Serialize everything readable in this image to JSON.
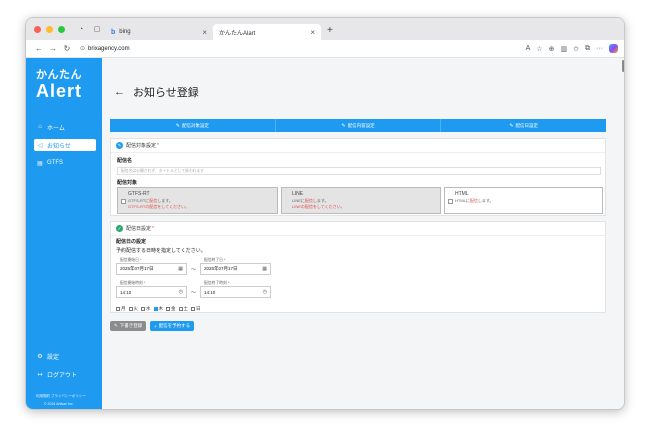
{
  "browser": {
    "tabs": [
      {
        "label": "bing",
        "active": false
      },
      {
        "label": "かんたんAlart",
        "active": true
      }
    ],
    "url": "brixagency.com"
  },
  "sidebar": {
    "logo_top": "かんたん",
    "logo_bottom": "Alert",
    "items": [
      {
        "label": "ホーム",
        "icon": "home-icon"
      },
      {
        "label": "お知らせ",
        "icon": "megaphone-icon",
        "active": true
      },
      {
        "label": "GTFS",
        "icon": "file-icon"
      }
    ],
    "bottom_items": [
      {
        "label": "設定",
        "icon": "gear-icon"
      },
      {
        "label": "ログアウト",
        "icon": "logout-icon"
      }
    ],
    "footer_links": "利用規約   プライバシーポリシー",
    "footer_copy": "© 2024 Artisan Inc."
  },
  "page": {
    "title": "お知らせ登録",
    "steps": [
      "配信対象設定",
      "配信内容設定",
      "配信日設定"
    ]
  },
  "card1": {
    "header": "配信対象設定",
    "name_label": "配信名",
    "name_placeholder": "配信名は公開されず、タイトルとして扱われます",
    "target_label": "配信対象",
    "targets": [
      {
        "title": "GTFS-RT",
        "sub_prefix": "GTFS-RTに",
        "sub_em": "配信",
        "sub_suffix": "します。",
        "note": "GTFS-RTの配信をしてください。",
        "disabled": true
      },
      {
        "title": "LINE",
        "sub_prefix": "LINEに",
        "sub_em": "配信",
        "sub_suffix": "します。",
        "note": "LINEの配信をしてください。",
        "disabled": true
      },
      {
        "title": "HTML",
        "sub_prefix": "HTMLに",
        "sub_em": "配信",
        "sub_suffix": "します。",
        "note": "",
        "disabled": false
      }
    ]
  },
  "card2": {
    "header": "配信日設定",
    "section_label": "配信日の設定",
    "hint": "予約配信する日時を指定してください。",
    "start_date_label": "配信開始日 *",
    "start_date": "2025年07月17日",
    "end_date_label": "配信終了日 *",
    "end_date": "2025年07月17日",
    "start_time_label": "配信開始時刻 *",
    "start_time": "14:10",
    "end_time_label": "配信終了時刻 *",
    "end_time": "14:10",
    "tilde": "〜",
    "days": [
      {
        "label": "月",
        "checked": false
      },
      {
        "label": "火",
        "checked": false
      },
      {
        "label": "水",
        "checked": false
      },
      {
        "label": "木",
        "checked": true
      },
      {
        "label": "金",
        "checked": false
      },
      {
        "label": "土",
        "checked": false
      },
      {
        "label": "日",
        "checked": false
      }
    ]
  },
  "actions": {
    "draft": "下書き登録",
    "book": "配信を予約する"
  },
  "colors": {
    "accent": "#1e9af0",
    "error": "#e04b4b",
    "success": "#2aa96b"
  }
}
